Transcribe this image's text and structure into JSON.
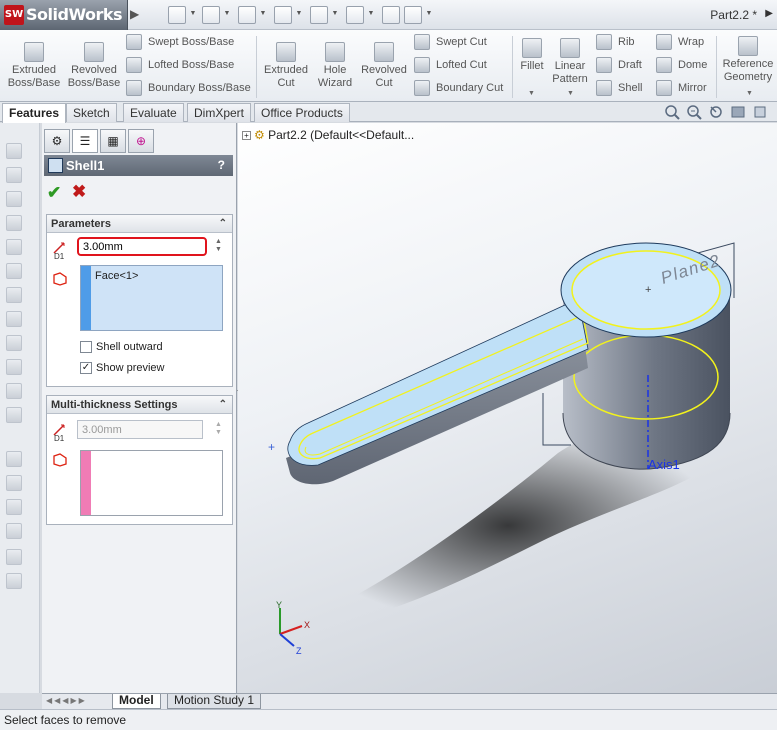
{
  "app": {
    "brand": "SolidWorks",
    "brand_badge": "SW",
    "window_title": "Part2.2 *"
  },
  "ribbon": {
    "extruded_boss": "Extruded Boss/Base",
    "revolved_boss": "Revolved Boss/Base",
    "swept_boss": "Swept Boss/Base",
    "lofted_boss": "Lofted Boss/Base",
    "boundary_boss": "Boundary Boss/Base",
    "extruded_cut": "Extruded Cut",
    "hole_wizard": "Hole Wizard",
    "revolved_cut": "Revolved Cut",
    "swept_cut": "Swept Cut",
    "lofted_cut": "Lofted Cut",
    "boundary_cut": "Boundary Cut",
    "fillet": "Fillet",
    "linear_pattern": "Linear Pattern",
    "rib": "Rib",
    "draft": "Draft",
    "shell": "Shell",
    "wrap": "Wrap",
    "dome": "Dome",
    "mirror": "Mirror",
    "reference_geometry": "Reference Geometry"
  },
  "tabs": [
    {
      "label": "Features",
      "active": true
    },
    {
      "label": "Sketch",
      "active": false
    },
    {
      "label": "Evaluate",
      "active": false
    },
    {
      "label": "DimXpert",
      "active": false
    },
    {
      "label": "Office Products",
      "active": false
    }
  ],
  "property_manager": {
    "title": "Shell1",
    "help": "?",
    "parameters": {
      "header": "Parameters",
      "thickness": "3.00mm",
      "thickness_icon_label": "D1",
      "faces": "Face<1>",
      "shell_outward_label": "Shell outward",
      "shell_outward_checked": false,
      "show_preview_label": "Show preview",
      "show_preview_checked": true
    },
    "multi_thickness": {
      "header": "Multi-thickness Settings",
      "thickness": "3.00mm",
      "thickness_icon_label": "D1"
    }
  },
  "graphics": {
    "tree_root": "Part2.2  (Default<<Default...",
    "plane_label": "Plane2",
    "axis_label": "Axis1",
    "triad": {
      "x": "X",
      "y": "Y",
      "z": "Z"
    }
  },
  "bottom_tabs": [
    {
      "label": "Model",
      "active": true
    },
    {
      "label": "Motion Study 1",
      "active": false
    }
  ],
  "status": {
    "message": "Select faces to remove"
  },
  "colors": {
    "accent_red": "#e0141d",
    "selection_blue": "#cfe3f7",
    "model_face": "#bfe0f7",
    "highlight_yellow": "#f2f21c"
  }
}
